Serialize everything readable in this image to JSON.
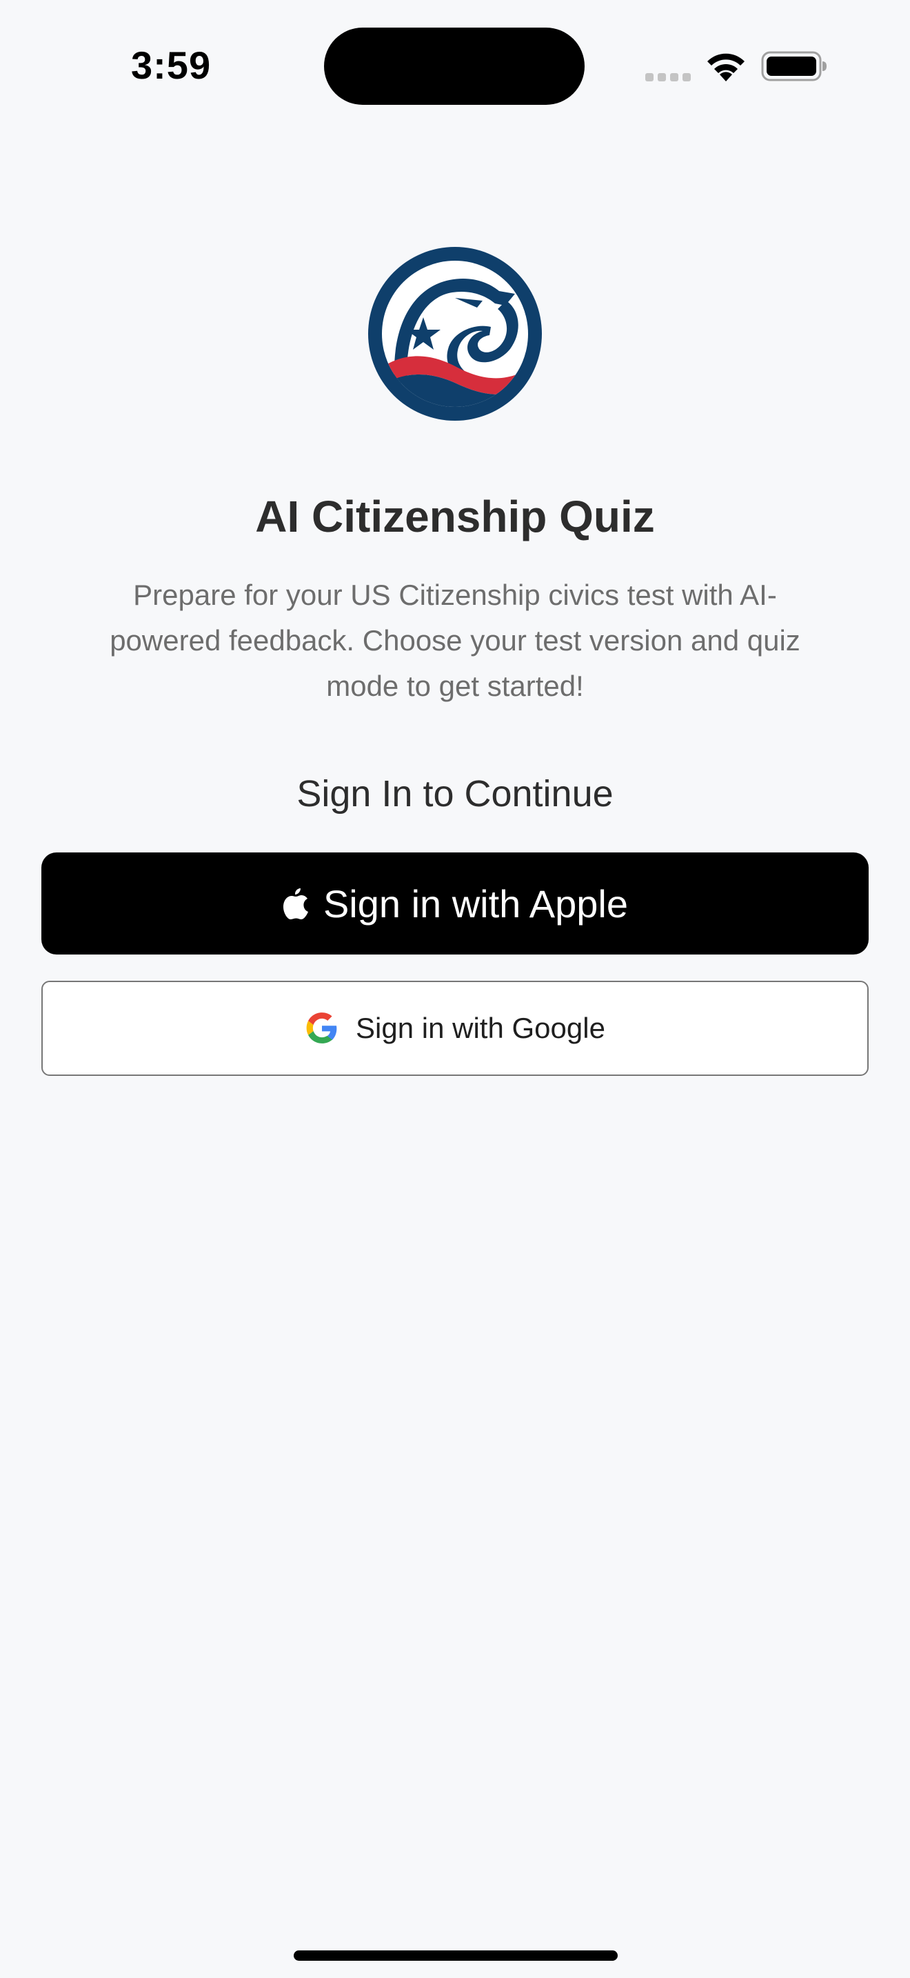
{
  "status_bar": {
    "time": "3:59",
    "icons": [
      "signal-icon",
      "wifi-icon",
      "battery-icon"
    ]
  },
  "logo": {
    "icon": "eagle-logo-icon",
    "colors": {
      "navy": "#0f3f6b",
      "red": "#d62e3c",
      "white": "#ffffff"
    }
  },
  "header": {
    "title": "AI Citizenship Quiz",
    "description": "Prepare for your US Citizenship civics test with AI-powered feedback. Choose your test version and quiz mode to get started!"
  },
  "sign_in": {
    "section_title": "Sign In to Continue",
    "apple_label": "Sign in with Apple",
    "google_label": "Sign in with Google",
    "apple_icon": "apple-icon",
    "google_icon": "google-icon"
  },
  "theme": {
    "background": "#f7f8fa",
    "apple_button_bg": "#000000",
    "google_button_bg": "#ffffff"
  }
}
